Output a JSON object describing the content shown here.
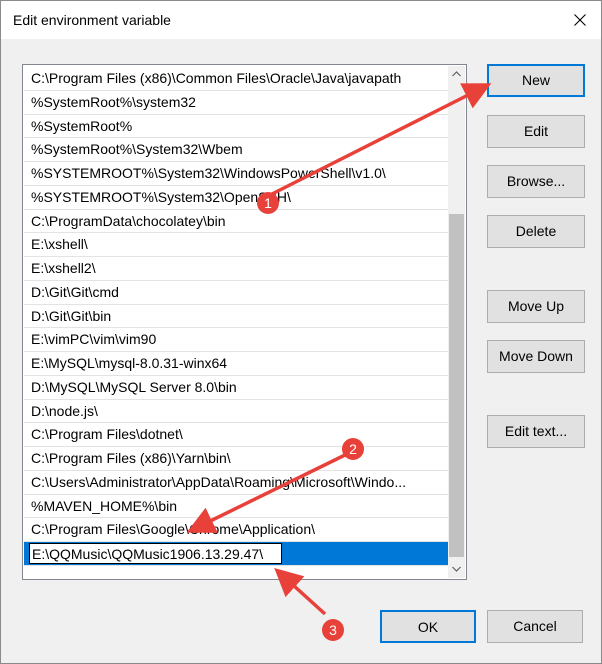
{
  "window": {
    "title": "Edit environment variable"
  },
  "list": {
    "items": [
      "C:\\Program Files (x86)\\Common Files\\Oracle\\Java\\javapath",
      "%SystemRoot%\\system32",
      "%SystemRoot%",
      "%SystemRoot%\\System32\\Wbem",
      "%SYSTEMROOT%\\System32\\WindowsPowerShell\\v1.0\\",
      "%SYSTEMROOT%\\System32\\OpenSSH\\",
      "C:\\ProgramData\\chocolatey\\bin",
      "E:\\xshell\\",
      "E:\\xshell2\\",
      "D:\\Git\\Git\\cmd",
      "D:\\Git\\Git\\bin",
      "E:\\vimPC\\vim\\vim90",
      "E:\\MySQL\\mysql-8.0.31-winx64",
      "D:\\MySQL\\MySQL Server 8.0\\bin",
      "D:\\node.js\\",
      "C:\\Program Files\\dotnet\\",
      "C:\\Program Files (x86)\\Yarn\\bin\\",
      "C:\\Users\\Administrator\\AppData\\Roaming\\Microsoft\\Windo...",
      "%MAVEN_HOME%\\bin",
      "C:\\Program Files\\Google\\Chrome\\Application\\"
    ],
    "editing_value": "E:\\QQMusic\\QQMusic1906.13.29.47\\"
  },
  "buttons": {
    "new": "New",
    "edit": "Edit",
    "browse": "Browse...",
    "delete": "Delete",
    "move_up": "Move Up",
    "move_down": "Move Down",
    "edit_text": "Edit text...",
    "ok": "OK",
    "cancel": "Cancel"
  },
  "annotations": {
    "color": "#e8413a",
    "markers": [
      "1",
      "2",
      "3"
    ]
  },
  "colors": {
    "selection": "#0078d7",
    "default_button_border": "#0078d7"
  }
}
